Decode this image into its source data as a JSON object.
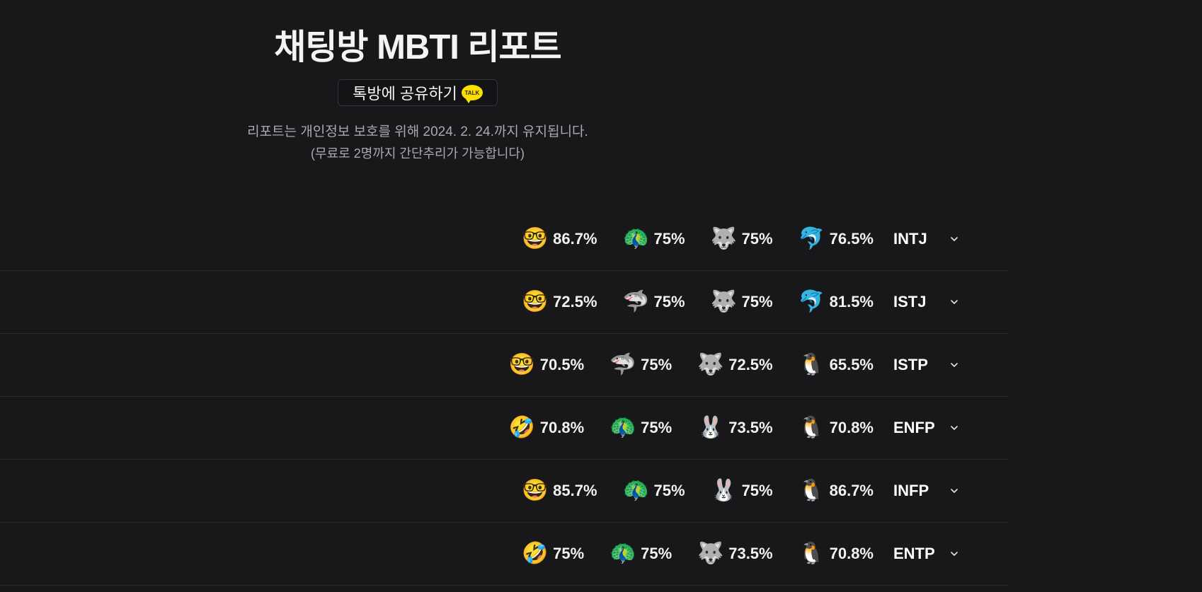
{
  "header": {
    "title": "채팅방 MBTI 리포트",
    "share_label": "톡방에 공유하기",
    "talk_badge": "TALK",
    "notice_line1": "리포트는 개인정보 보호를 위해 2024. 2. 24.까지 유지됩니다.",
    "notice_line2": "(무료로 2명까지 간단추리가 가능합니다)"
  },
  "rows": [
    {
      "cells": [
        {
          "icon": "nerd-face-icon",
          "emoji": "🤓",
          "pct": "86.7%"
        },
        {
          "icon": "peacock-icon",
          "emoji": "🦚",
          "pct": "75%"
        },
        {
          "icon": "wolf-icon",
          "emoji": "🐺",
          "pct": "75%"
        },
        {
          "icon": "dolphin-icon",
          "emoji": "🐬",
          "pct": "76.5%"
        }
      ],
      "mbti": "INTJ"
    },
    {
      "cells": [
        {
          "icon": "nerd-face-icon",
          "emoji": "🤓",
          "pct": "72.5%"
        },
        {
          "icon": "shark-icon",
          "emoji": "🦈",
          "pct": "75%"
        },
        {
          "icon": "wolf-icon",
          "emoji": "🐺",
          "pct": "75%"
        },
        {
          "icon": "dolphin-icon",
          "emoji": "🐬",
          "pct": "81.5%"
        }
      ],
      "mbti": "ISTJ"
    },
    {
      "cells": [
        {
          "icon": "nerd-face-icon",
          "emoji": "🤓",
          "pct": "70.5%"
        },
        {
          "icon": "shark-icon",
          "emoji": "🦈",
          "pct": "75%"
        },
        {
          "icon": "wolf-icon",
          "emoji": "🐺",
          "pct": "72.5%"
        },
        {
          "icon": "penguin-icon",
          "emoji": "🐧",
          "pct": "65.5%"
        }
      ],
      "mbti": "ISTP"
    },
    {
      "cells": [
        {
          "icon": "rolling-laugh-icon",
          "emoji": "🤣",
          "pct": "70.8%"
        },
        {
          "icon": "peacock-icon",
          "emoji": "🦚",
          "pct": "75%"
        },
        {
          "icon": "rabbit-icon",
          "emoji": "🐰",
          "pct": "73.5%"
        },
        {
          "icon": "penguin-icon",
          "emoji": "🐧",
          "pct": "70.8%"
        }
      ],
      "mbti": "ENFP"
    },
    {
      "cells": [
        {
          "icon": "nerd-face-icon",
          "emoji": "🤓",
          "pct": "85.7%"
        },
        {
          "icon": "peacock-icon",
          "emoji": "🦚",
          "pct": "75%"
        },
        {
          "icon": "rabbit-icon",
          "emoji": "🐰",
          "pct": "75%"
        },
        {
          "icon": "penguin-icon",
          "emoji": "🐧",
          "pct": "86.7%"
        }
      ],
      "mbti": "INFP"
    },
    {
      "cells": [
        {
          "icon": "rolling-laugh-icon",
          "emoji": "🤣",
          "pct": "75%"
        },
        {
          "icon": "peacock-icon",
          "emoji": "🦚",
          "pct": "75%"
        },
        {
          "icon": "wolf-icon",
          "emoji": "🐺",
          "pct": "73.5%"
        },
        {
          "icon": "penguin-icon",
          "emoji": "🐧",
          "pct": "70.8%"
        }
      ],
      "mbti": "ENTP"
    }
  ]
}
